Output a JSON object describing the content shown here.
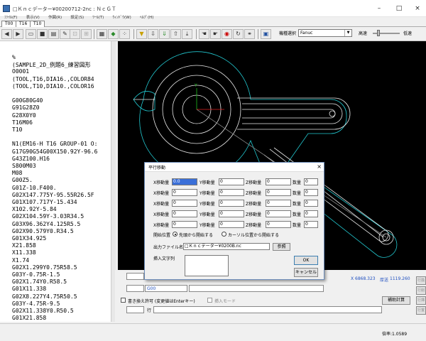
{
  "window": {
    "title": "□Ｋｎｃデーター¥00200712-2nc : ＮｃＧＴ",
    "minimize": "–",
    "maximize": "□",
    "close": "×"
  },
  "menu": [
    "ﾌｧｲﾙ(F)",
    "表示(V)",
    "作図(R)",
    "設定(S)",
    "ﾂｰﾙ(T)",
    "ｳｨﾝﾄﾞｳ(W)",
    "ﾍﾙﾌﾟ(H)"
  ],
  "tabs": [
    "T00",
    "T16",
    "T10"
  ],
  "toolbar": {
    "model_label": "機種選択",
    "model_value": "Fanuc",
    "speed_high": "高速",
    "speed_low": "低速"
  },
  "code_lines": [
    "%",
    "(SAMPLE_2D_例題6_練習図形",
    "O0001",
    "(TOOL,T16,DIA16.,COLOR84",
    "(TOOL,T10,DIA10.,COLOR16",
    "",
    "G00G80G40",
    "G91G28Z0",
    "G28X0Y0",
    "T16M06",
    "T10",
    "",
    "N1(EM16-H T16 GROUP-01 O:",
    "G17G90G54G00X150.92Y-96.6",
    "G43Z100.H16",
    "S800M03",
    "M08",
    "G00Z5.",
    "G01Z-10.F400.",
    "G02X147.775Y-95.55R26.5F",
    "G01X107.717Y-15.434",
    "X102.92Y-5.84",
    "G02X104.59Y-3.03R34.5",
    "G03X96.362Y4.125R5.5",
    "G02X90.579Y0.R34.5",
    "G01X34.925",
    "X21.858",
    "X11.338",
    "X1.74",
    "G02X1.299Y0.75R58.5",
    "G03Y-0.75R-1.5",
    "G02X1.74Y0.R58.5",
    "G01X11.338",
    "G02X8.227Y4.75R50.5",
    "G03Y-4.75R-9.5",
    "G02X11.338Y0.R50.5",
    "G01X21.858"
  ],
  "bottom": {
    "mode_value": "G00",
    "coord_x_label": "X",
    "coord_x_value": "6868.323",
    "coord_y_label": "厚送",
    "coord_y_value": "1119.260",
    "overwrite_label": "書き換え許可 (変更値はEnterキー)",
    "insert_mode_label": "挿入モード",
    "line_label": "行",
    "calc_button": "補助計算",
    "side_buttons": [
      "行換",
      "行削",
      "行挿",
      "行置"
    ],
    "status_text": "倍率:1.0589"
  },
  "dialog": {
    "title": "平行移動",
    "close": "×",
    "col_x": "X移動量",
    "col_y": "Y移動量",
    "col_z": "Z移動量",
    "col_n": "数量",
    "rows": [
      {
        "x": "0.0",
        "y": "0",
        "z": "0",
        "n": "0"
      },
      {
        "x": "0",
        "y": "0",
        "z": "0",
        "n": "0"
      },
      {
        "x": "0",
        "y": "0",
        "z": "0",
        "n": "0"
      },
      {
        "x": "0",
        "y": "0",
        "z": "0",
        "n": "0"
      },
      {
        "x": "0",
        "y": "0",
        "z": "0",
        "n": "0"
      }
    ],
    "start_label": "開始位置",
    "radio_head": "先頭から開始する",
    "radio_cursor": "カーソル位置から開始する",
    "file_label": "出力ファイル名",
    "file_value": "□Ｋｎｃデーター¥0200B.nc",
    "browse": "参照",
    "insert_label": "挿入文字列",
    "ok": "OK",
    "cancel": "キャンセル"
  },
  "colors": {
    "toolpath": "#22c8d0",
    "path_white": "#e8e8e8",
    "axis_x": "#e02020",
    "axis_y": "#20c020",
    "accent": "#6b8bb8"
  }
}
